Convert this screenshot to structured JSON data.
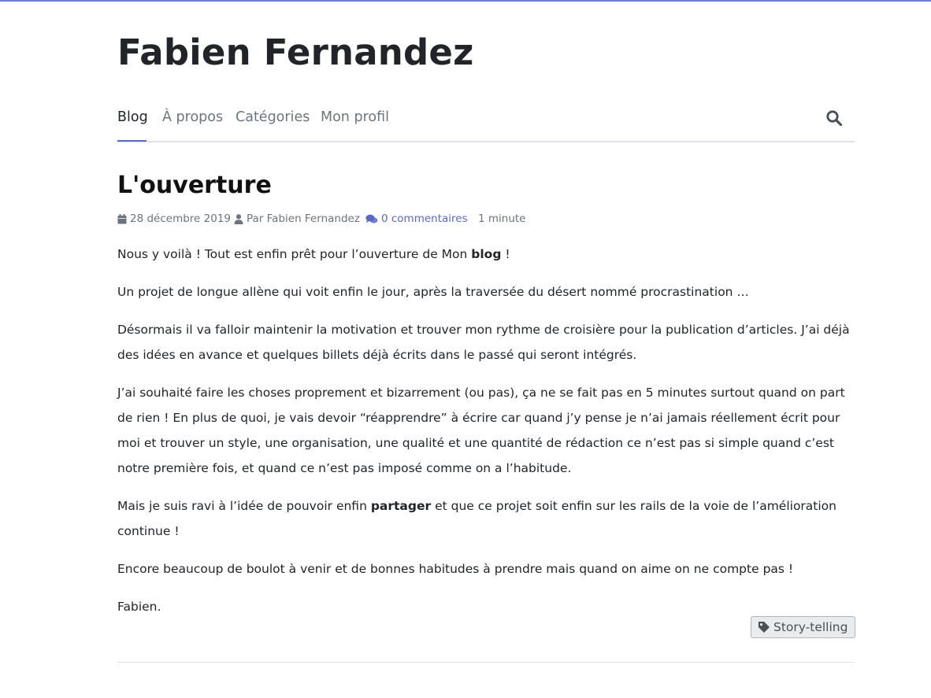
{
  "site": {
    "title": "Fabien Fernandez"
  },
  "nav": {
    "items": [
      {
        "label": "Blog",
        "active": true
      },
      {
        "label": "À propos"
      },
      {
        "label": "Catégories"
      },
      {
        "label": "Mon profil"
      }
    ],
    "search_icon": "search-icon"
  },
  "post": {
    "title": "L'ouverture",
    "meta": {
      "date": "28 décembre 2019",
      "author": "Par Fabien Fernandez",
      "comments": "0 commentaires",
      "reading_time": "1 minute"
    },
    "paragraphs": [
      {
        "before": "Nous y voilà ! Tout est enfin prêt pour l’ouverture de Mon ",
        "bold": "blog",
        "after": " !"
      },
      {
        "text": "Un projet de longue allène qui voit enfin le jour, après la traversée du désert nommé procrastination …"
      },
      {
        "text": "Désormais il va falloir maintenir la motivation et trouver mon rythme de croisière pour la publication d’articles. J’ai déjà des idées en avance et quelques billets déjà écrits dans le passé qui seront intégrés."
      },
      {
        "text": "J’ai souhaité faire les choses proprement et bizarrement (ou pas), ça ne se fait pas en 5 minutes surtout quand on part de rien ! En plus de quoi, je vais devoir “réapprendre” à écrire car quand j’y pense je n’ai jamais réellement écrit pour moi et trouver un style, une organisation, une qualité et une quantité de rédaction ce n’est pas si simple quand c’est notre première fois, et quand ce n’est pas imposé comme on a l’habitude."
      },
      {
        "before": "Mais je suis ravi à l’idée de pouvoir enfin ",
        "bold": "partager",
        "after": " et que ce projet soit enfin sur les rails de la voie de l’amélioration continue !"
      },
      {
        "text": "Encore beaucoup de boulot à venir et de bonnes habitudes à prendre mais quand on aime on ne compte pas !"
      },
      {
        "text": "Fabien."
      }
    ],
    "tag": "Story-telling"
  },
  "colors": {
    "accent": "#5a6ac4",
    "top_bar": "#6c7bd3",
    "text": "#212529",
    "muted": "#6c757d"
  }
}
